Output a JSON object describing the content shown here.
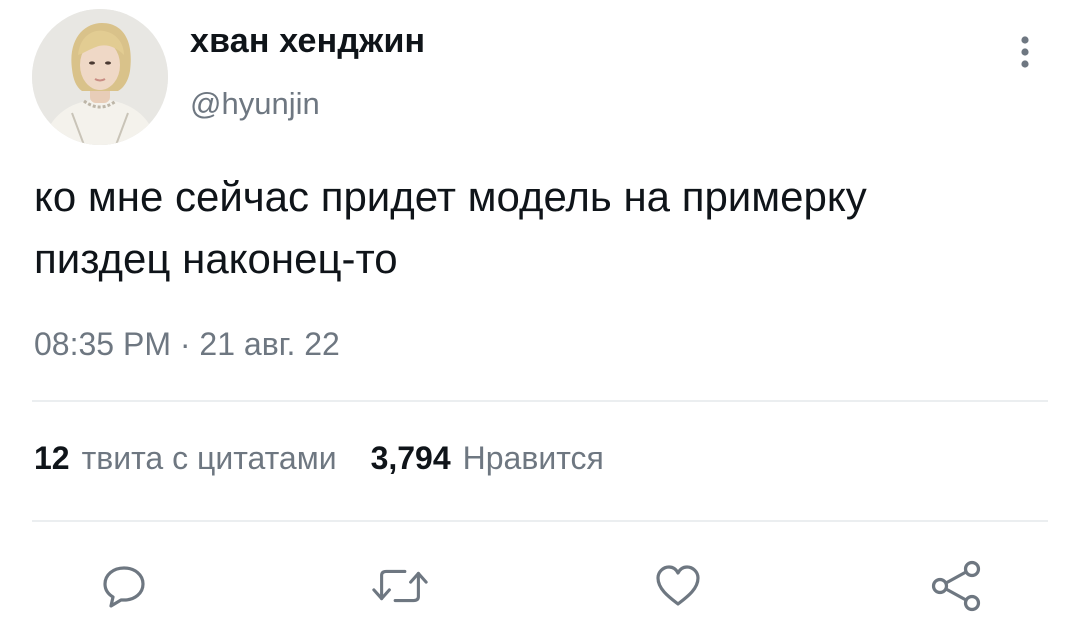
{
  "user": {
    "display_name": "хван хенджин",
    "handle": "@hyunjin",
    "avatar_icon": "avatar-photo"
  },
  "tweet": {
    "text": "ко мне сейчас придет модель на примерку пиздец наконец-то",
    "timestamp": "08:35 PM · 21 авг. 22"
  },
  "stats": {
    "quotes_count": "12",
    "quotes_label": "твита с цитатами",
    "likes_count": "3,794",
    "likes_label": "Нравится"
  },
  "actions": [
    {
      "name": "reply",
      "icon": "speech-bubble-icon"
    },
    {
      "name": "retweet",
      "icon": "retweet-icon"
    },
    {
      "name": "like",
      "icon": "heart-icon"
    },
    {
      "name": "share",
      "icon": "share-icon"
    }
  ],
  "colors": {
    "text_primary": "#0f1419",
    "text_secondary": "#6e7781",
    "icon": "#6e7781",
    "divider": "#ebeef0"
  }
}
